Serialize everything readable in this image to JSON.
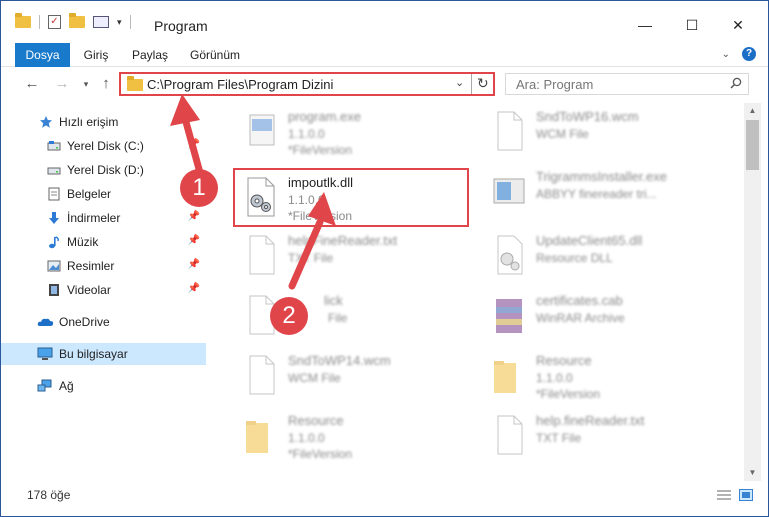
{
  "window": {
    "title": "Program"
  },
  "ribbon": {
    "tabs": [
      "Dosya",
      "Giriş",
      "Paylaş",
      "Görünüm"
    ],
    "help": "?"
  },
  "address": {
    "path": "C:\\Program Files\\Program Dizini"
  },
  "search": {
    "placeholder": "Ara: Program"
  },
  "nav": {
    "items": [
      {
        "label": "Hızlı erişim",
        "icon": "star-icon"
      },
      {
        "label": "Yerel Disk (C:)",
        "icon": "drive-icon"
      },
      {
        "label": "Yerel Disk (D:)",
        "icon": "drive-icon"
      },
      {
        "label": "Belgeler",
        "icon": "documents-icon"
      },
      {
        "label": "İndirmeler",
        "icon": "download-icon"
      },
      {
        "label": "Müzik",
        "icon": "music-icon"
      },
      {
        "label": "Resimler",
        "icon": "pictures-icon"
      },
      {
        "label": "Videolar",
        "icon": "video-icon"
      },
      {
        "label": "OneDrive",
        "icon": "cloud-icon"
      },
      {
        "label": "Bu bilgisayar",
        "icon": "computer-icon"
      },
      {
        "label": "Ağ",
        "icon": "network-icon"
      }
    ]
  },
  "files": [
    {
      "name": "program.exe",
      "sub": "1.1.0.0",
      "sub2": "*FileVersion",
      "icon": "exe-icon"
    },
    {
      "name": "SndToWP16.wcm",
      "sub": "WCM File",
      "sub2": "",
      "icon": "file-icon"
    },
    {
      "name": "impoutlk.dll",
      "sub": "1.1.0.0",
      "sub2": "*FileVersion",
      "icon": "dll-gear-icon"
    },
    {
      "name": "TrigrammsInstaller.exe",
      "sub": "ABBYY finereader tri...",
      "sub2": "",
      "icon": "installer-icon"
    },
    {
      "name": "helpFineReader.txt",
      "sub": "TXT File",
      "sub2": "",
      "icon": "file-icon"
    },
    {
      "name": "UpdateClient65.dll",
      "sub": "Resource DLL",
      "sub2": "",
      "icon": "dll-gear-icon"
    },
    {
      "name": "lick",
      "sub": "File",
      "sub2": "",
      "icon": "file-icon"
    },
    {
      "name": "certificates.cab",
      "sub": "WinRAR Archive",
      "sub2": "",
      "icon": "archive-icon"
    },
    {
      "name": "SndToWP14.wcm",
      "sub": "WCM File",
      "sub2": "",
      "icon": "file-icon"
    },
    {
      "name": "Resource",
      "sub": "1.1.0.0",
      "sub2": "*FileVersion",
      "icon": "folder-icon"
    },
    {
      "name": "Resource",
      "sub": "1.1.0.0",
      "sub2": "*FileVersion",
      "icon": "folder-icon"
    },
    {
      "name": "help.fineReader.txt",
      "sub": "TXT File",
      "sub2": "",
      "icon": "file-icon"
    }
  ],
  "status": {
    "count": "178 öğe"
  },
  "callouts": {
    "one": "1",
    "two": "2"
  },
  "colors": {
    "accent": "#1979ca",
    "highlight": "#e0454a",
    "selected": "#cce8ff"
  }
}
